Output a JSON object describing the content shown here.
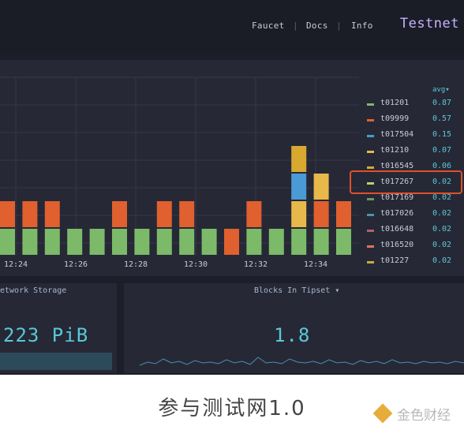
{
  "nav": {
    "items": [
      "Faucet",
      "Docs",
      "Info"
    ],
    "brand": "Testnet"
  },
  "legend": {
    "header": "avg▾",
    "items": [
      {
        "name": "t01201",
        "value": "0.87",
        "color": "#7cba6a"
      },
      {
        "name": "t09999",
        "value": "0.57",
        "color": "#e0602f"
      },
      {
        "name": "t017504",
        "value": "0.15",
        "color": "#4a9ad6"
      },
      {
        "name": "t01210",
        "value": "0.07",
        "color": "#e8b84a"
      },
      {
        "name": "t016545",
        "value": "0.06",
        "color": "#d9a830"
      },
      {
        "name": "t017267",
        "value": "0.02",
        "color": "#b8d36a"
      },
      {
        "name": "t017169",
        "value": "0.02",
        "color": "#6b9a63"
      },
      {
        "name": "t017026",
        "value": "0.02",
        "color": "#4a93b0"
      },
      {
        "name": "t016648",
        "value": "0.02",
        "color": "#b46262"
      },
      {
        "name": "t016520",
        "value": "0.02",
        "color": "#e0735a"
      },
      {
        "name": "t01227",
        "value": "0.02",
        "color": "#c9ab3a"
      }
    ]
  },
  "chart_data": {
    "type": "bar",
    "stacked": true,
    "categories": [
      "12:24",
      "12:26",
      "12:28",
      "12:30",
      "12:32",
      "12:34"
    ],
    "bars": [
      {
        "segments": [
          {
            "color": "#7cba6a",
            "value": 1
          },
          {
            "color": "#e0602f",
            "value": 1
          }
        ]
      },
      {
        "segments": [
          {
            "color": "#7cba6a",
            "value": 1
          },
          {
            "color": "#e0602f",
            "value": 1
          }
        ]
      },
      {
        "segments": [
          {
            "color": "#7cba6a",
            "value": 1
          },
          {
            "color": "#e0602f",
            "value": 1
          }
        ]
      },
      {
        "segments": [
          {
            "color": "#7cba6a",
            "value": 1
          }
        ]
      },
      {
        "segments": [
          {
            "color": "#7cba6a",
            "value": 1
          }
        ]
      },
      {
        "segments": [
          {
            "color": "#7cba6a",
            "value": 1
          },
          {
            "color": "#e0602f",
            "value": 1
          }
        ]
      },
      {
        "segments": [
          {
            "color": "#7cba6a",
            "value": 1
          }
        ]
      },
      {
        "segments": [
          {
            "color": "#7cba6a",
            "value": 1
          },
          {
            "color": "#e0602f",
            "value": 1
          }
        ]
      },
      {
        "segments": [
          {
            "color": "#7cba6a",
            "value": 1
          },
          {
            "color": "#e0602f",
            "value": 1
          }
        ]
      },
      {
        "segments": [
          {
            "color": "#7cba6a",
            "value": 1
          }
        ]
      },
      {
        "segments": [
          {
            "color": "#e0602f",
            "value": 1
          }
        ]
      },
      {
        "segments": [
          {
            "color": "#7cba6a",
            "value": 1
          },
          {
            "color": "#e0602f",
            "value": 1
          }
        ]
      },
      {
        "segments": [
          {
            "color": "#7cba6a",
            "value": 1
          }
        ]
      },
      {
        "segments": [
          {
            "color": "#7cba6a",
            "value": 1
          },
          {
            "color": "#e8b84a",
            "value": 1
          },
          {
            "color": "#4a9ad6",
            "value": 1
          },
          {
            "color": "#d9a830",
            "value": 1
          }
        ]
      },
      {
        "segments": [
          {
            "color": "#7cba6a",
            "value": 1
          },
          {
            "color": "#e0602f",
            "value": 1
          },
          {
            "color": "#e8b84a",
            "value": 1
          }
        ]
      },
      {
        "segments": [
          {
            "color": "#7cba6a",
            "value": 1
          },
          {
            "color": "#e0602f",
            "value": 1
          }
        ]
      }
    ]
  },
  "panels": {
    "storage": {
      "title": "etwork Storage",
      "value": "223 PiB"
    },
    "tipset": {
      "title": "Blocks In Tipset ▾",
      "value": "1.8"
    }
  },
  "caption": "参与测试网1.0",
  "watermark": "金色财经"
}
